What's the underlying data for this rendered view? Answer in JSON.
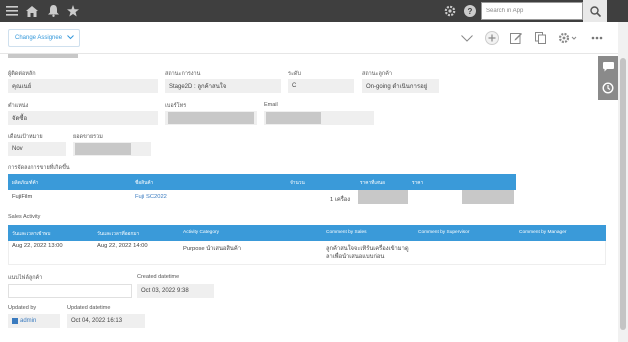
{
  "topbar": {
    "search_placeholder": "Search in App"
  },
  "toolbar": {
    "change_assignee_label": "Change Assignee"
  },
  "fields": {
    "contact_label": "ผู้ติดต่อหลัก",
    "contact_value": "คุณเนย์",
    "work_status_label": "สถานะการงาน",
    "work_status_value": "Stage2D : ลูกค้าสนใจ",
    "level_label": "ระดับ",
    "level_value": "C",
    "customer_status_label": "สถานะลูกค้า",
    "customer_status_value": "On-going ดำเนินการอยู่",
    "position_label": "ตำแหน่ง",
    "position_value": "จัดซื้อ",
    "phone_label": "เบอร์โทร",
    "email_label": "Email",
    "target_month_label": "เดือนเป้าหมาย",
    "target_month_value": "Nov",
    "sales_total_label": "ยอดขายรวม"
  },
  "products": {
    "section_title": "การจัดลงการขายที่เกิดขึ้น",
    "headers": [
      "ผลิตภัณฑ์ค้า",
      "ชื่อสินค้า",
      "จำนวน",
      "ราคาที่เสนอ",
      "ราคา"
    ],
    "rows": [
      {
        "customer": "FujiFilm",
        "product": "Fuji SC2022",
        "qty": "1 เครื่อง"
      }
    ]
  },
  "activity": {
    "section_title": "Sales Activity",
    "headers": [
      "วันและเวลาเข้าพบ",
      "วันและเวลาที่ออกมา",
      "Activity Category",
      "Comment by Sales",
      "Comment by Supervisor",
      "Comment by Manager"
    ],
    "rows": [
      {
        "start": "Aug 22, 2022 13:00",
        "end": "Aug 22, 2022 14:00",
        "category": "Purpose นำเสนอสินค้า",
        "comment_sales_1": "ลูกค้าสนใจจะเทิร์นเครื่องเข้ามาดู",
        "comment_sales_2": "ลาเพื่อนำเสนอแบบก่อน",
        "comment_supervisor": "",
        "comment_manager": ""
      }
    ]
  },
  "footer": {
    "attach_label": "แนบไฟล์ลูกค้า",
    "created_label": "Created datetime",
    "created_value": "Oct 03, 2022 9:38",
    "updated_by_label": "Updated by",
    "updated_by_value": "admin",
    "updated_dt_label": "Updated datetime",
    "updated_dt_value": "Oct 04, 2022 16:13"
  }
}
